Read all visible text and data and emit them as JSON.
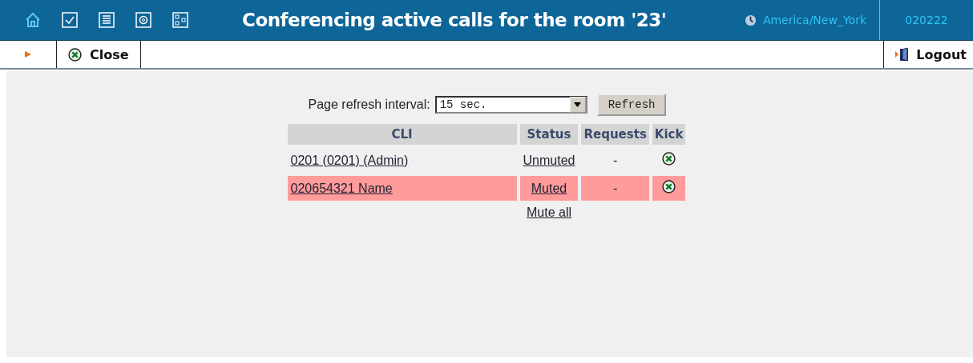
{
  "header": {
    "title": "Conferencing active calls for the room '23'",
    "timezone": "America/New_York",
    "user": "020222"
  },
  "toolbar": {
    "close": "Close",
    "logout": "Logout"
  },
  "refresh": {
    "label": "Page refresh interval:",
    "value": "15 sec.",
    "button": "Refresh"
  },
  "table": {
    "columns": [
      "CLI",
      "Status",
      "Requests",
      "Kick"
    ],
    "rows": [
      {
        "cli": "0201 (0201) (Admin)",
        "status": "Unmuted",
        "requests": "-",
        "muted": false
      },
      {
        "cli": "020654321 Name",
        "status": "Muted",
        "requests": "-",
        "muted": true
      }
    ],
    "mute_all": "Mute all"
  }
}
